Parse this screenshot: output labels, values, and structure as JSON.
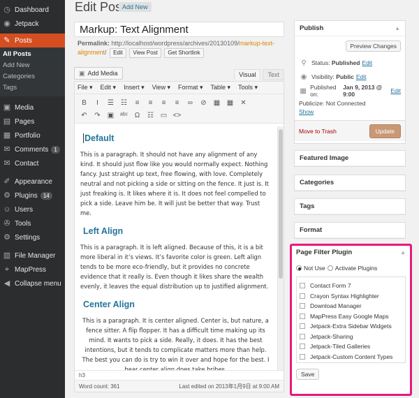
{
  "sidebar": {
    "items": [
      {
        "label": "Dashboard",
        "icon": "dashboard-icon",
        "glyph": "◷"
      },
      {
        "label": "Jetpack",
        "icon": "jetpack-icon",
        "glyph": "◉"
      }
    ],
    "posts": {
      "label": "Posts",
      "icon": "pin-icon",
      "glyph": "✎"
    },
    "posts_sub": [
      "All Posts",
      "Add New",
      "Categories",
      "Tags"
    ],
    "items2": [
      {
        "label": "Media",
        "icon": "media-icon",
        "glyph": "▣",
        "badge": ""
      },
      {
        "label": "Pages",
        "icon": "pages-icon",
        "glyph": "▤",
        "badge": ""
      },
      {
        "label": "Portfolio",
        "icon": "portfolio-icon",
        "glyph": "▦",
        "badge": ""
      },
      {
        "label": "Comments",
        "icon": "comments-icon",
        "glyph": "✉",
        "badge": "1"
      },
      {
        "label": "Contact",
        "icon": "contact-icon",
        "glyph": "✉",
        "badge": ""
      }
    ],
    "items3": [
      {
        "label": "Appearance",
        "icon": "appearance-icon",
        "glyph": "✐",
        "badge": ""
      },
      {
        "label": "Plugins",
        "icon": "plugins-icon",
        "glyph": "⚙",
        "badge": "14"
      },
      {
        "label": "Users",
        "icon": "users-icon",
        "glyph": "☺",
        "badge": ""
      },
      {
        "label": "Tools",
        "icon": "tools-icon",
        "glyph": "✇",
        "badge": ""
      },
      {
        "label": "Settings",
        "icon": "settings-icon",
        "glyph": "⚙",
        "badge": ""
      }
    ],
    "items4": [
      {
        "label": "File Manager",
        "icon": "file-manager-icon",
        "glyph": "▥"
      },
      {
        "label": "MapPress",
        "icon": "mappress-icon",
        "glyph": "⌖"
      },
      {
        "label": "Collapse menu",
        "icon": "collapse-icon",
        "glyph": "◀"
      }
    ]
  },
  "header": {
    "title": "Edit Post",
    "add_new": "Add New"
  },
  "post": {
    "title": "Markup: Text Alignment",
    "permalink_label": "Permalink:",
    "permalink_base": "http://localhost/wordpress/archives/20130109/",
    "permalink_slug": "markup-text-alignment",
    "permalink_end": "/",
    "edit_btn": "Edit",
    "view_btn": "View Post",
    "shortlink_btn": "Get Shortlink"
  },
  "editor": {
    "add_media": "Add Media",
    "tab_visual": "Visual",
    "tab_text": "Text",
    "menus": [
      "File",
      "Edit",
      "Insert",
      "View",
      "Format",
      "Table",
      "Tools"
    ],
    "toolbar1": [
      {
        "name": "bold-icon",
        "g": "B"
      },
      {
        "name": "italic-icon",
        "g": "I"
      },
      {
        "name": "bullet-list-icon",
        "g": "☰"
      },
      {
        "name": "numbered-list-icon",
        "g": "☷"
      },
      {
        "name": "align-left-icon",
        "g": "≡"
      },
      {
        "name": "align-center-icon",
        "g": "≡"
      },
      {
        "name": "align-right-icon",
        "g": "≡"
      },
      {
        "name": "align-justify-icon",
        "g": "≡"
      },
      {
        "name": "link-icon",
        "g": "∞"
      },
      {
        "name": "unlink-icon",
        "g": "⊘"
      },
      {
        "name": "image-icon",
        "g": "▦"
      },
      {
        "name": "table-icon",
        "g": "▦"
      },
      {
        "name": "fullscreen-icon",
        "g": "✕"
      }
    ],
    "toolbar2": [
      {
        "name": "undo-icon",
        "g": "↶"
      },
      {
        "name": "redo-icon",
        "g": "↷"
      },
      {
        "name": "media-insert-icon",
        "g": "▣"
      },
      {
        "name": "spellcheck-icon",
        "g": "ᵃᵇᶜ"
      },
      {
        "name": "special-char-icon",
        "g": "Ω"
      },
      {
        "name": "list-style-icon",
        "g": "☷"
      },
      {
        "name": "more-icon",
        "g": "▭"
      },
      {
        "name": "code-icon",
        "g": "<>"
      }
    ],
    "sections": [
      {
        "heading": "Default",
        "align": "left",
        "text": "This is a paragraph. It should not have any alignment of any kind. It should just flow like you would normally expect. Nothing fancy. Just straight up text, free flowing, with love. Completely neutral and not picking a side or sitting on the fence. It just is. It just freaking is. It likes where it is. It does not feel compelled to pick a side. Leave him be. It will just be better that way. Trust me."
      },
      {
        "heading": "Left Align",
        "align": "left",
        "text": "This is a paragraph. It is left aligned. Because of this, it is a bit more liberal in it’s views. It’s favorite color is green. Left align tends to be more eco-friendly, but it provides no concrete evidence that it really is. Even though it likes share the wealth evenly, it leaves the equal distribution up to justified alignment."
      },
      {
        "heading": "Center Align",
        "align": "center",
        "text": "This is a paragraph. It is center aligned. Center is, but nature, a fence sitter. A flip flopper. It has a difficult time making up its mind. It wants to pick a side. Really, it does. It has the best intentions, but it tends to complicate matters more than help. The best you can do is try to win it over and hope for the best. I hear center align does take bribes."
      }
    ],
    "path": "h3",
    "word_count": "Word count: 361",
    "last_edited": "Last edited on 2013年1月9日 at 9:00 AM"
  },
  "publish": {
    "title": "Publish",
    "preview": "Preview Changes",
    "status_label": "Status:",
    "status_value": "Published",
    "visibility_label": "Visibility:",
    "visibility_value": "Public",
    "published_label": "Published on:",
    "published_value": "Jan 9, 2013 @ 9:00",
    "edit": "Edit",
    "publicize": "Publicize: Not Connected",
    "show": "Show",
    "trash": "Move to Trash",
    "update": "Update"
  },
  "boxes": [
    "Featured Image",
    "Categories",
    "Tags",
    "Format"
  ],
  "page_filter": {
    "title": "Page Filter Plugin",
    "opt_not_use": "Not Use",
    "opt_activate": "Activate Plugins",
    "plugins": [
      "Contact Form 7",
      "Crayon Syntax Highlighter",
      "Download Manager",
      "MapPress Easy Google Maps",
      "Jetpack-Extra Sidebar Widgets",
      "Jetpack-Sharing",
      "Jetpack-Tiled Galleries",
      "Jetpack-Custom Content Types"
    ],
    "save": "Save"
  },
  "colors": {
    "accent": "#d54e21",
    "link": "#21759b",
    "highlight_border": "#e8197a",
    "update_button": "#c99877"
  }
}
